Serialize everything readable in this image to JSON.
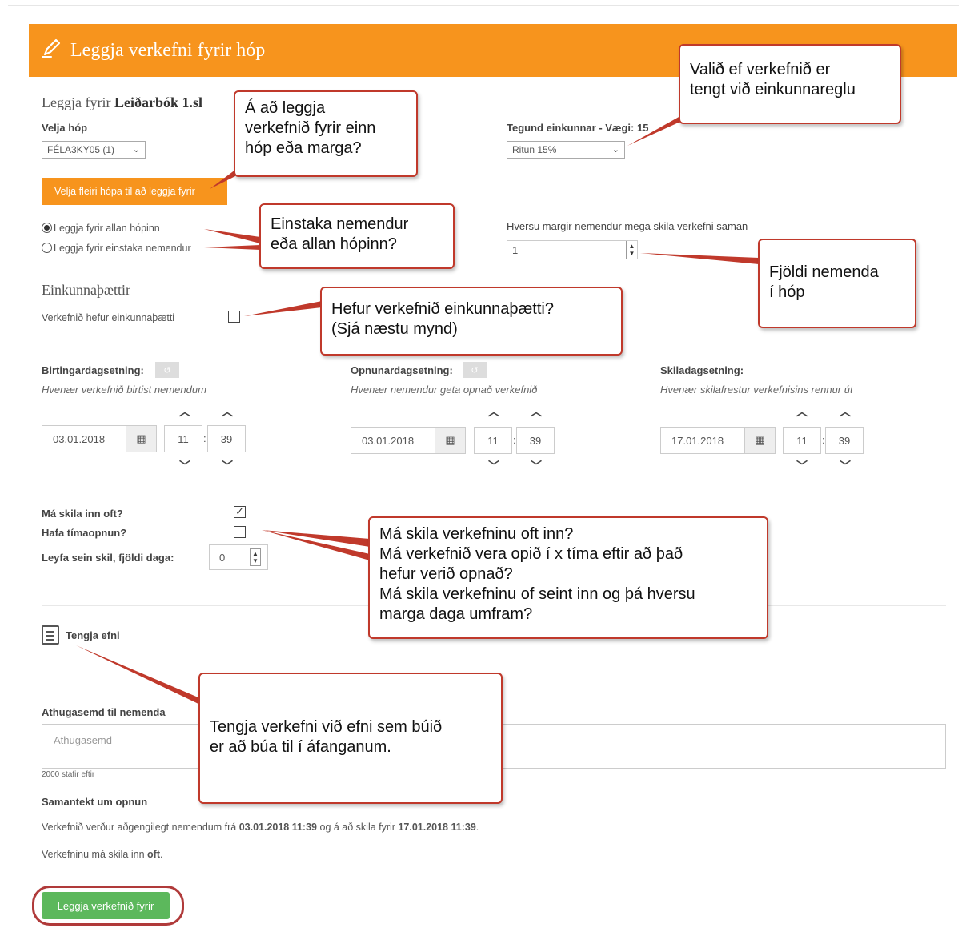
{
  "header": {
    "title": "Leggja verkefni fyrir hóp"
  },
  "form": {
    "assign_prefix": "Leggja fyrir ",
    "assign_name": "Leiðarbók 1.sl",
    "group_label": "Velja hóp",
    "group_value": "FÉLA3KY05 (1)",
    "multi_group_button": "Velja fleiri hópa til að leggja fyrir",
    "grade_type_label": "Tegund einkunnar - Vægi: 15",
    "grade_type_value": "Ritun 15%",
    "radio_all": "Leggja fyrir allan hópinn",
    "radio_individual": "Leggja fyrir einstaka nemendur",
    "group_size_label": "Hversu margir nemendur mega skila verkefni saman",
    "group_size_value": "1",
    "rubric_heading": "Einkunnaþættir",
    "rubric_checkbox_label": "Verkefnið hefur einkunnaþætti",
    "dates": [
      {
        "label": "Birtingardagsetning:",
        "hint": "Hvenær verkefnið birtist nemendum",
        "date": "03.01.2018",
        "hour": "11",
        "minute": "39"
      },
      {
        "label": "Opnunardagsetning:",
        "hint": "Hvenær nemendur geta opnað verkefnið",
        "date": "03.01.2018",
        "hour": "11",
        "minute": "39"
      },
      {
        "label": "Skiladagsetning:",
        "hint": "Hvenær skilafrestur verkefnisins rennur út",
        "date": "17.01.2018",
        "hour": "11",
        "minute": "39"
      }
    ],
    "multi_submit_label": "Má skila inn oft?",
    "timed_label": "Hafa tímaopnun?",
    "late_label": "Leyfa sein skil, fjöldi daga:",
    "late_value": "0",
    "link_content": "Tengja efni",
    "comment_label": "Athugasemd til nemenda",
    "comment_placeholder": "Athugasemd",
    "chars_left": "2000 stafir eftir",
    "summary_heading": "Samantekt um opnun",
    "summary_line1_a": "Verkefnið verður aðgengilegt nemendum frá ",
    "summary_line1_b": "03.01.2018 11:39",
    "summary_line1_c": " og á að skila fyrir ",
    "summary_line1_d": "17.01.2018 11:39",
    "summary_line1_e": ".",
    "summary_line2_a": "Verkefninu má skila inn ",
    "summary_line2_b": "oft",
    "summary_line2_c": ".",
    "submit_button": "Leggja verkefnið fyrir"
  },
  "callouts": {
    "c1": [
      "Á að leggja",
      "verkefnið fyrir einn",
      "hóp eða marga?"
    ],
    "c2": [
      "Valið ef verkefnið er",
      "tengt við einkunnareglu"
    ],
    "c3": [
      "Einstaka nemendur",
      "eða allan hópinn?"
    ],
    "c4": [
      "Fjöldi nemenda",
      "í hóp"
    ],
    "c5": [
      "Hefur verkefnið einkunnaþætti?",
      "(Sjá næstu mynd)"
    ],
    "c6": [
      "Má skila verkefninu oft inn?",
      "Má verkefnið vera opið í x tíma eftir að það",
      "hefur verið opnað?",
      "Má skila verkefninu of seint inn og þá hversu",
      "marga daga umfram?"
    ],
    "c7": [
      "Tengja verkefni við efni sem búið",
      "er að búa til í áfanganum."
    ]
  },
  "colors": {
    "accent": "#f7941d",
    "submit": "#5cb85c",
    "callout_border": "#c0392b"
  },
  "icons": [
    "pencil-icon",
    "chevron-down-icon",
    "calendar-icon",
    "chevron-up-icon",
    "spinner-icon",
    "document-icon",
    "reset-icon"
  ]
}
